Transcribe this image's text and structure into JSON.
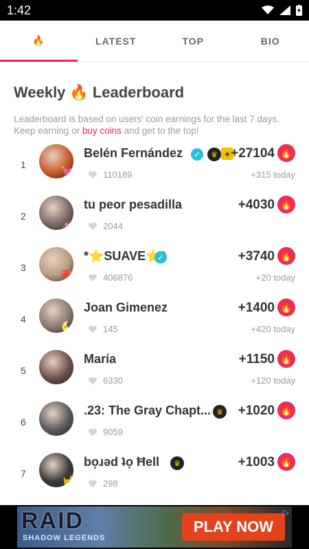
{
  "status_bar": {
    "time": "1:42"
  },
  "tabs": [
    {
      "label": "🔥",
      "active": true
    },
    {
      "label": "LATEST",
      "active": false
    },
    {
      "label": "TOP",
      "active": false
    },
    {
      "label": "BIO",
      "active": false
    }
  ],
  "header": {
    "title_pre": "Weekly",
    "title_emoji": "🔥",
    "title_post": "Leaderboard",
    "subtitle_pre": "Leaderboard is based on users' coin earnings for the last 7 days. Keep earning or ",
    "subtitle_link": "buy coins",
    "subtitle_post": " and get to the top!"
  },
  "leaderboard": [
    {
      "rank": "1",
      "name": "Belén Fernández",
      "likes": "110189",
      "score": "+27104",
      "today": "+315 today",
      "verified": true,
      "crown": true,
      "plus": true,
      "avatar_color": "#c85a2a",
      "avatar_badge": "💘"
    },
    {
      "rank": "2",
      "name": "tu peor pesadilla",
      "likes": "2044",
      "score": "+4030",
      "today": "",
      "verified": false,
      "crown": false,
      "plus": false,
      "avatar_color": "#7a6a66",
      "avatar_badge": "💩"
    },
    {
      "rank": "3",
      "name": "*⭐SUAVE⭐*",
      "likes": "406876",
      "score": "+3740",
      "today": "+20 today",
      "verified": true,
      "crown": false,
      "plus": false,
      "avatar_color": "#b89a80",
      "avatar_badge": "💔"
    },
    {
      "rank": "4",
      "name": "Joan Gimenez",
      "likes": "145",
      "score": "+1400",
      "today": "+420 today",
      "verified": false,
      "crown": false,
      "plus": false,
      "avatar_color": "#8a7a70",
      "avatar_badge": "🌜"
    },
    {
      "rank": "5",
      "name": "María",
      "likes": "6330",
      "score": "+1150",
      "today": "+120 today",
      "verified": false,
      "crown": false,
      "plus": false,
      "avatar_color": "#6a5048",
      "avatar_badge": ""
    },
    {
      "rank": "6",
      "name": ".23: The Gray Chapt...",
      "likes": "9059",
      "score": "+1020",
      "today": "",
      "verified": false,
      "crown": true,
      "plus": false,
      "avatar_color": "#5a5a5a",
      "avatar_badge": ""
    },
    {
      "rank": "7",
      "name": "bo̦ɹǝd ʇo̦ Ħell",
      "likes": "298",
      "score": "+1003",
      "today": "",
      "verified": false,
      "crown": true,
      "plus": false,
      "avatar_color": "#3a3a3a",
      "avatar_badge": "🤘"
    }
  ],
  "ad": {
    "brand": "RAID",
    "tagline": "SHADOW LEGENDS",
    "cta": "PLAY NOW"
  },
  "colors": {
    "accent": "#e8264f",
    "verified": "#26c1d9",
    "crown": "#f2c200"
  }
}
